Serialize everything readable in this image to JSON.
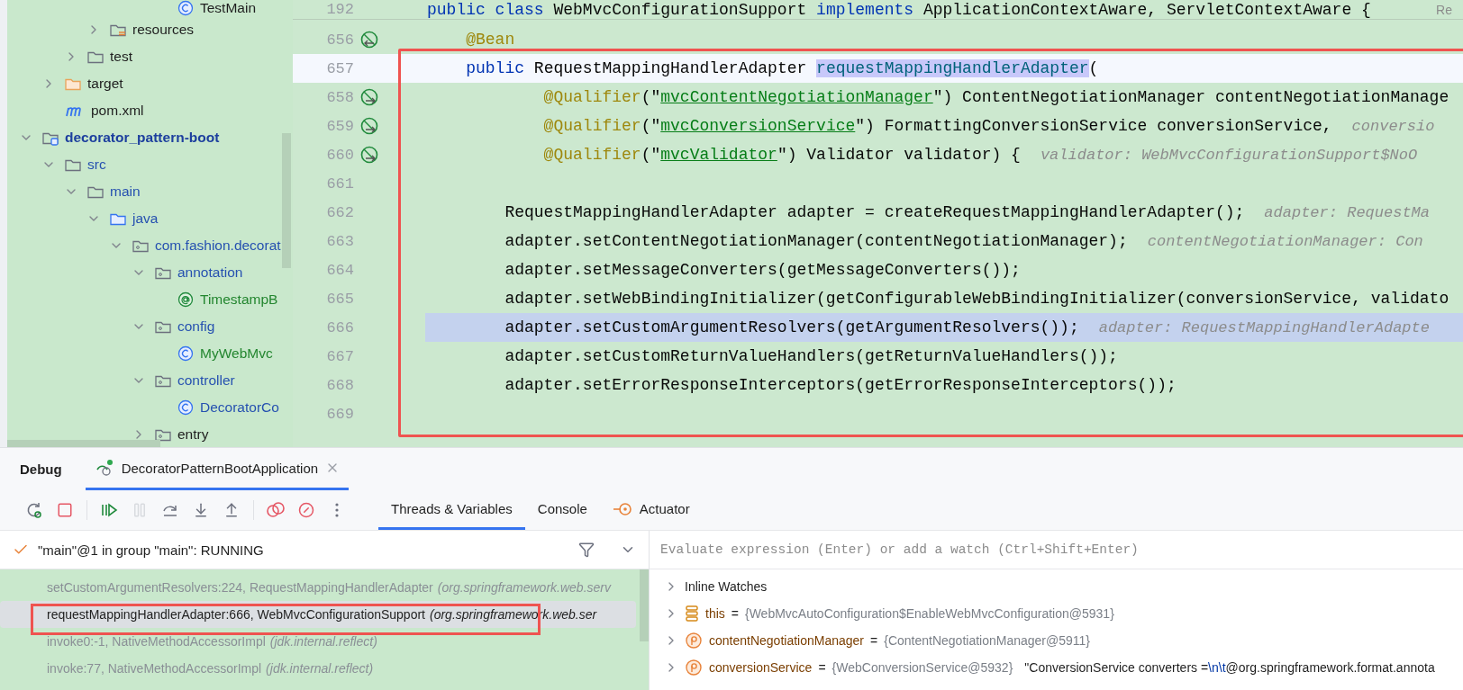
{
  "project_tree": {
    "items": [
      {
        "children": [
          {
            "children": [
              {
                "children": [
                  {
                    "children": [
                      {
                        "children": [
                          {
                            "children": [
                              {
                                "label": "TestMain",
                                "kind": "class",
                                "color": "#1f1f1f"
                              }
                            ]
                          }
                        ]
                      }
                    ]
                  },
                  {
                    "label": "resources",
                    "kind": "resources-folder",
                    "expanded": false,
                    "color": "#1f1f1f"
                  }
                ]
              },
              {
                "label": "test",
                "kind": "folder",
                "expanded": false,
                "color": "#1f1f1f"
              }
            ]
          },
          {
            "label": "target",
            "kind": "excluded-folder",
            "expanded": false,
            "color": "#1f1f1f"
          },
          {
            "label": "pom.xml",
            "kind": "maven",
            "color": "#1f1f1f"
          }
        ]
      },
      {
        "label": "decorator_pattern-boot",
        "kind": "module",
        "expanded": true,
        "color": "#1d3f9e",
        "children": [
          {
            "label": "src",
            "kind": "folder",
            "expanded": true,
            "color": "#2651b0",
            "children": [
              {
                "label": "main",
                "kind": "folder",
                "expanded": true,
                "color": "#2651b0",
                "children": [
                  {
                    "label": "java",
                    "kind": "source-folder",
                    "expanded": true,
                    "color": "#2651b0",
                    "children": [
                      {
                        "label": "com.fashion.decorat",
                        "kind": "package",
                        "expanded": true,
                        "color": "#2651b0",
                        "children": [
                          {
                            "label": "annotation",
                            "kind": "package",
                            "expanded": true,
                            "color": "#2651b0",
                            "children": [
                              {
                                "label": "TimestampB",
                                "kind": "annotation",
                                "color": "#23862f"
                              }
                            ]
                          },
                          {
                            "label": "config",
                            "kind": "package",
                            "expanded": true,
                            "color": "#2651b0",
                            "children": [
                              {
                                "label": "MyWebMvc",
                                "kind": "class",
                                "color": "#23862f"
                              }
                            ]
                          },
                          {
                            "label": "controller",
                            "kind": "package",
                            "expanded": true,
                            "color": "#2651b0",
                            "children": [
                              {
                                "label": "DecoratorCo",
                                "kind": "class",
                                "color": "#2651b0"
                              }
                            ]
                          },
                          {
                            "label": "entry",
                            "kind": "package",
                            "expanded": false,
                            "color": "#1f1f1f"
                          }
                        ]
                      }
                    ]
                  }
                ]
              }
            ]
          }
        ]
      }
    ]
  },
  "editor": {
    "sticky_line": {
      "number": "192",
      "tokens": [
        {
          "kind": "kw",
          "s": "public class"
        },
        {
          "kind": "plain",
          "s": " WebMvcConfigurationSupport "
        },
        {
          "kind": "kw",
          "s": "implements"
        },
        {
          "kind": "plain",
          "s": " ApplicationContextAware, ServletContextAware {"
        }
      ]
    },
    "reader_mode": "Re",
    "red_box": true,
    "lines": [
      {
        "number": "656",
        "kind": "bean-left",
        "caret_line": false,
        "execution_point": false,
        "tokens": [
          {
            "kind": "ann",
            "s": "    @Bean"
          }
        ]
      },
      {
        "number": "657",
        "kind": "plain",
        "caret_line": true,
        "execution_point": false,
        "tokens": [
          {
            "kind": "kw",
            "s": "    public"
          },
          {
            "kind": "plain",
            "s": " RequestMappingHandlerAdapter "
          },
          {
            "kind": "decl",
            "s": "requestMappingHandlerAdapter"
          },
          {
            "kind": "plain",
            "s": "("
          }
        ]
      },
      {
        "number": "658",
        "kind": "bean-right",
        "caret_line": false,
        "execution_point": false,
        "tokens": [
          {
            "kind": "ann",
            "s": "            @Qualifier"
          },
          {
            "kind": "plain",
            "s": "(\""
          },
          {
            "kind": "str",
            "s": "mvcContentNegotiationManager"
          },
          {
            "kind": "plain",
            "s": "\") ContentNegotiationManager contentNegotiationManage"
          }
        ]
      },
      {
        "number": "659",
        "kind": "bean-right",
        "caret_line": false,
        "execution_point": false,
        "tokens": [
          {
            "kind": "ann",
            "s": "            @Qualifier"
          },
          {
            "kind": "plain",
            "s": "(\""
          },
          {
            "kind": "str",
            "s": "mvcConversionService"
          },
          {
            "kind": "plain",
            "s": "\") FormattingConversionService conversionService,"
          },
          {
            "kind": "hint",
            "s": "conversio"
          }
        ]
      },
      {
        "number": "660",
        "kind": "bean-right",
        "caret_line": false,
        "execution_point": false,
        "tokens": [
          {
            "kind": "ann",
            "s": "            @Qualifier"
          },
          {
            "kind": "plain",
            "s": "(\""
          },
          {
            "kind": "str",
            "s": "mvcValidator"
          },
          {
            "kind": "plain",
            "s": "\") Validator validator) {"
          },
          {
            "kind": "hint",
            "s": "validator: WebMvcConfigurationSupport$NoO"
          }
        ]
      },
      {
        "number": "661",
        "kind": "plain",
        "caret_line": false,
        "execution_point": false
      },
      {
        "number": "662",
        "kind": "plain",
        "caret_line": false,
        "execution_point": false,
        "tokens": [
          {
            "kind": "plain",
            "s": "        RequestMappingHandlerAdapter adapter = createRequestMappingHandlerAdapter();"
          },
          {
            "kind": "hint",
            "s": "adapter: RequestMa"
          }
        ]
      },
      {
        "number": "663",
        "kind": "plain",
        "caret_line": false,
        "execution_point": false,
        "tokens": [
          {
            "kind": "plain",
            "s": "        adapter.setContentNegotiationManager(contentNegotiationManager);"
          },
          {
            "kind": "hint",
            "s": "contentNegotiationManager: Con"
          }
        ]
      },
      {
        "number": "664",
        "kind": "plain",
        "caret_line": false,
        "execution_point": false,
        "tokens": [
          {
            "kind": "plain",
            "s": "        adapter.setMessageConverters(getMessageConverters());"
          }
        ]
      },
      {
        "number": "665",
        "kind": "plain",
        "caret_line": false,
        "execution_point": false,
        "tokens": [
          {
            "kind": "plain",
            "s": "        adapter.setWebBindingInitializer(getConfigurableWebBindingInitializer(conversionService, validato"
          }
        ]
      },
      {
        "number": "666",
        "kind": "plain",
        "caret_line": false,
        "execution_point": true,
        "tokens": [
          {
            "kind": "plain",
            "s": "        adapter.setCustomArgumentResolvers(getArgumentResolvers());"
          },
          {
            "kind": "hint",
            "s": "adapter: RequestMappingHandlerAdapte"
          }
        ]
      },
      {
        "number": "667",
        "kind": "plain",
        "caret_line": false,
        "execution_point": false,
        "tokens": [
          {
            "kind": "plain",
            "s": "        adapter.setCustomReturnValueHandlers(getReturnValueHandlers());"
          }
        ]
      },
      {
        "number": "668",
        "kind": "plain",
        "caret_line": false,
        "execution_point": false,
        "tokens": [
          {
            "kind": "plain",
            "s": "        adapter.setErrorResponseInterceptors(getErrorResponseInterceptors());"
          }
        ]
      },
      {
        "number": "669",
        "kind": "plain",
        "caret_line": false,
        "execution_point": false
      }
    ]
  },
  "debug": {
    "title": "Debug",
    "tabs": [
      {
        "label": "DecoratorPatternBootApplication",
        "selected": true
      }
    ],
    "toolbar": [
      {
        "kind": "rerun",
        "disabled": false
      },
      {
        "kind": "stop",
        "disabled": false
      },
      {
        "kind": "separator"
      },
      {
        "kind": "resume",
        "disabled": false
      },
      {
        "kind": "pause",
        "disabled": true
      },
      {
        "kind": "step-over",
        "disabled": false
      },
      {
        "kind": "step-into",
        "disabled": false
      },
      {
        "kind": "step-out",
        "disabled": false
      },
      {
        "kind": "separator"
      },
      {
        "kind": "breakpoints",
        "disabled": false
      },
      {
        "kind": "mute",
        "disabled": false
      },
      {
        "kind": "more",
        "disabled": false
      }
    ],
    "view_tabs": [
      {
        "label": "Threads & Variables",
        "kind": "plain",
        "selected": true
      },
      {
        "label": "Console",
        "kind": "plain",
        "selected": false
      },
      {
        "label": "Actuator",
        "kind": "actuator",
        "selected": false
      }
    ],
    "thread": {
      "label": "\"main\"@1 in group \"main\": RUNNING"
    },
    "frames": [
      {
        "method": "setCustomArgumentResolvers:224, RequestMappingHandlerAdapter",
        "package": "(org.springframework.web.serv",
        "selected": false,
        "boxed": false
      },
      {
        "method": "requestMappingHandlerAdapter:666, WebMvcConfigurationSupport",
        "package": "(org.springframework.web.ser",
        "selected": true,
        "boxed": true
      },
      {
        "method": "invoke0:-1, NativeMethodAccessorImpl",
        "package": "(jdk.internal.reflect)",
        "selected": false,
        "boxed": false
      },
      {
        "method": "invoke:77, NativeMethodAccessorImpl",
        "package": "(jdk.internal.reflect)",
        "selected": false,
        "boxed": false
      }
    ],
    "watch_field": {
      "placeholder": "Evaluate expression (Enter) or add a watch (Ctrl+Shift+Enter)"
    },
    "variables": [
      {
        "kind": "watches",
        "name": "Inline Watches"
      },
      {
        "kind": "this",
        "name": "this",
        "operator": "=",
        "value": "{WebMvcAutoConfiguration$EnableWebMvcConfiguration@5931}"
      },
      {
        "kind": "parameter",
        "name": "contentNegotiationManager",
        "operator": "=",
        "value": "{ContentNegotiationManager@5911}"
      },
      {
        "kind": "parameter",
        "name": "conversionService",
        "operator": "=",
        "value": "{WebConversionService@5932}",
        "extra": [
          {
            "kind": "str",
            "s": "\"ConversionService converters ="
          },
          {
            "kind": "esc",
            "s": "\\n\\t"
          },
          {
            "kind": "str",
            "s": "@org.springframework.format.annota"
          }
        ]
      }
    ]
  }
}
